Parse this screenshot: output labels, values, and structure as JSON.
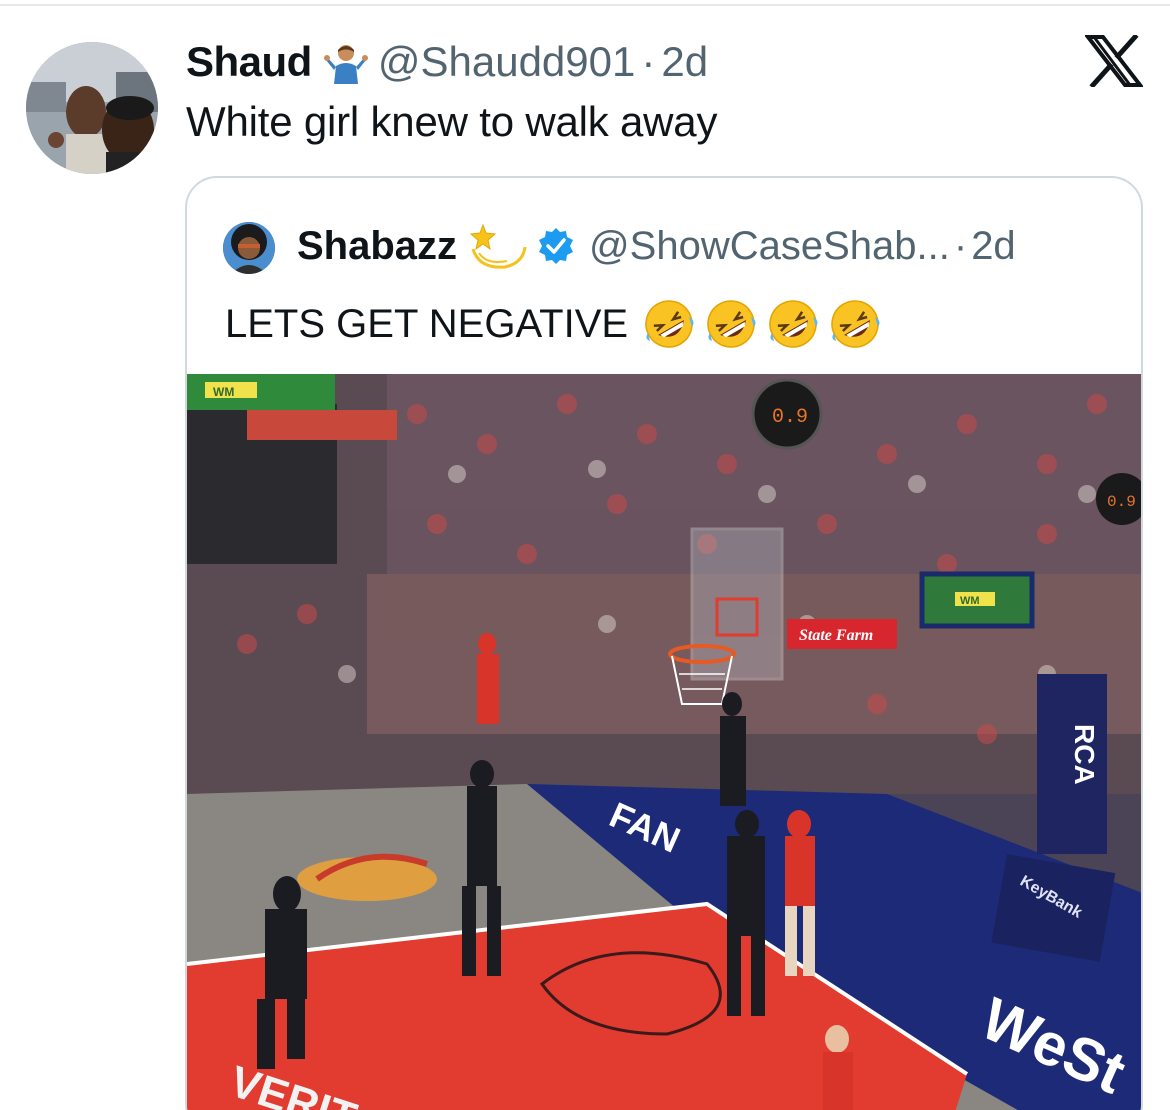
{
  "tweet": {
    "display_name": "Shaud",
    "handle": "@Shaudd901",
    "separator": "·",
    "time": "2d",
    "text": "White girl knew to walk away",
    "name_emoji": "person-shrugging-emoji"
  },
  "quoted_tweet": {
    "display_name": "Shabazz",
    "name_emoji": "dizzy-star-emoji",
    "verified": true,
    "handle": "@ShowCaseShab...",
    "separator": "·",
    "time": "2d",
    "text": "LETS GET NEGATIVE",
    "trailing_emojis": [
      "rolling-on-floor-laughing-emoji",
      "rolling-on-floor-laughing-emoji",
      "rolling-on-floor-laughing-emoji",
      "rolling-on-floor-laughing-emoji"
    ],
    "media": {
      "type": "video-frame",
      "description_icon": "basketball-game-image",
      "shot_clock_1": "0.9",
      "shot_clock_2": "0.9",
      "sponsor_statefarm": "State Farm",
      "sponsor_keybank": "KeyBank",
      "sponsor_rca": "RCA",
      "sponsor_wm": "WM",
      "floor_text": "FAN",
      "baseline_text": "WeSt",
      "paint_text": "VERIT"
    }
  },
  "colors": {
    "secondary_text": "#536471",
    "verified_blue": "#1d9bf0",
    "card_border": "#cfd9de",
    "court_red": "#e23b2f",
    "court_blue": "#1c2a78"
  }
}
